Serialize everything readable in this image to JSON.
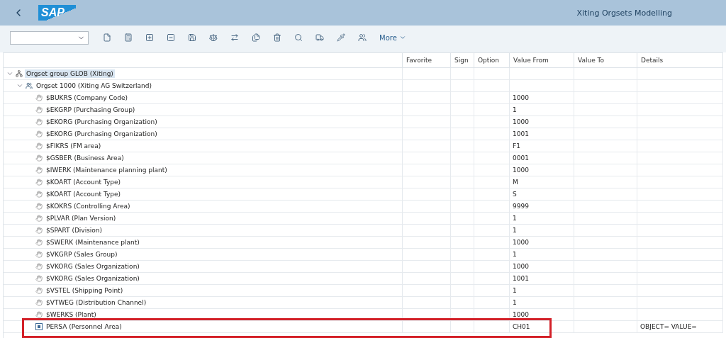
{
  "header": {
    "logo": "SAP",
    "title": "Xiting Orgsets Modelling"
  },
  "toolbar": {
    "more": "More"
  },
  "table": {
    "columns": [
      "Favorite",
      "Sign",
      "Option",
      "Value From",
      "Value To",
      "Details"
    ],
    "tree": [
      {
        "kind": "group",
        "label": "Orgset group GLOB (Xiting)",
        "expanded": true,
        "selected": true,
        "children": [
          {
            "kind": "orgset",
            "label": "Orgset 1000 (Xiting AG Switzerland)",
            "expanded": true,
            "selected": false,
            "children": [
              {
                "kind": "field",
                "label": "$BUKRS (Company Code)",
                "value_from": "1000",
                "selected": false
              },
              {
                "kind": "field",
                "label": "$EKGRP (Purchasing Group)",
                "value_from": "1",
                "selected": false
              },
              {
                "kind": "field",
                "label": "$EKORG (Purchasing Organization)",
                "value_from": "1000",
                "selected": false
              },
              {
                "kind": "field",
                "label": "$EKORG (Purchasing Organization)",
                "value_from": "1001",
                "selected": false
              },
              {
                "kind": "field",
                "label": "$FIKRS (FM area)",
                "value_from": "F1",
                "selected": false
              },
              {
                "kind": "field",
                "label": "$GSBER (Business Area)",
                "value_from": "0001",
                "selected": false
              },
              {
                "kind": "field",
                "label": "$IWERK (Maintenance planning plant)",
                "value_from": "1000",
                "selected": false
              },
              {
                "kind": "field",
                "label": "$KOART (Account Type)",
                "value_from": "M",
                "selected": false
              },
              {
                "kind": "field",
                "label": "$KOART (Account Type)",
                "value_from": "S",
                "selected": false
              },
              {
                "kind": "field",
                "label": "$KOKRS (Controlling Area)",
                "value_from": "9999",
                "selected": false
              },
              {
                "kind": "field",
                "label": "$PLVAR (Plan Version)",
                "value_from": "1",
                "selected": false
              },
              {
                "kind": "field",
                "label": "$SPART (Division)",
                "value_from": "1",
                "selected": false
              },
              {
                "kind": "field",
                "label": "$SWERK (Maintenance plant)",
                "value_from": "1000",
                "selected": false
              },
              {
                "kind": "field",
                "label": "$VKGRP (Sales Group)",
                "value_from": "1",
                "selected": false
              },
              {
                "kind": "field",
                "label": "$VKORG (Sales Organization)",
                "value_from": "1000",
                "selected": false
              },
              {
                "kind": "field",
                "label": "$VKORG (Sales Organization)",
                "value_from": "1001",
                "selected": false
              },
              {
                "kind": "field",
                "label": "$VSTEL (Shipping Point)",
                "value_from": "1",
                "selected": false
              },
              {
                "kind": "field",
                "label": "$VTWEG (Distribution Channel)",
                "value_from": "1",
                "selected": false
              },
              {
                "kind": "field",
                "label": "$WERKS (Plant)",
                "value_from": "1000",
                "selected": false
              },
              {
                "kind": "object",
                "label": "PERSA (Personnel Area)",
                "value_from": "CH01",
                "details": "OBJECT= VALUE=",
                "selected": false,
                "highlighted": true
              }
            ]
          }
        ]
      }
    ]
  }
}
